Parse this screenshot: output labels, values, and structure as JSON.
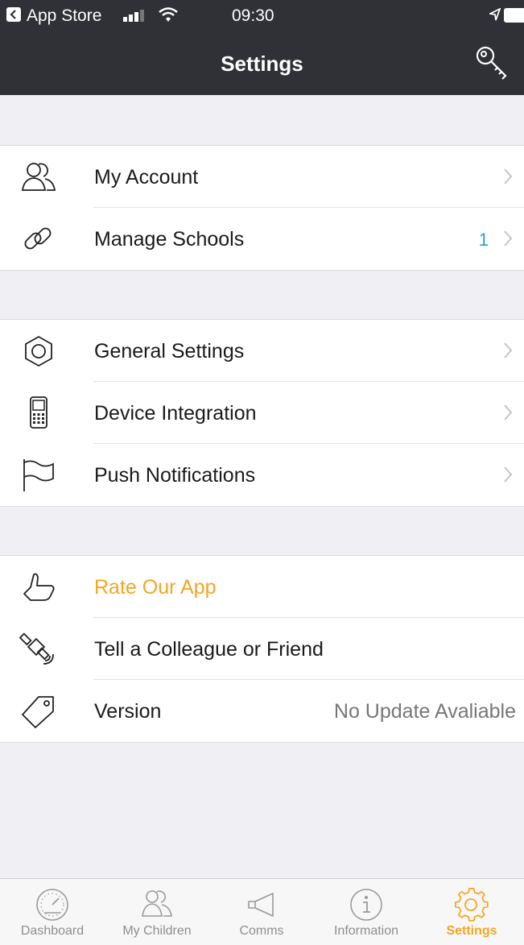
{
  "status_bar": {
    "carrier": "App Store",
    "time": "09:30"
  },
  "nav": {
    "title": "Settings",
    "right_icon": "key-icon"
  },
  "sections": [
    {
      "rows": [
        {
          "icon": "users-icon",
          "label": "My Account",
          "chevron": true
        },
        {
          "icon": "link-icon",
          "label": "Manage Schools",
          "count": "1",
          "chevron": true
        }
      ]
    },
    {
      "rows": [
        {
          "icon": "hexagon-settings-icon",
          "label": "General Settings",
          "chevron": true
        },
        {
          "icon": "device-icon",
          "label": "Device Integration",
          "chevron": true
        },
        {
          "icon": "flag-icon",
          "label": "Push Notifications",
          "chevron": true
        }
      ]
    },
    {
      "rows": [
        {
          "icon": "thumbs-up-icon",
          "label": "Rate Our App",
          "accent": true
        },
        {
          "icon": "satellite-icon",
          "label": "Tell a Colleague or Friend"
        },
        {
          "icon": "tag-icon",
          "label": "Version",
          "value": "No Update Avaliable"
        }
      ]
    }
  ],
  "tabbar": {
    "tabs": [
      {
        "icon": "speedometer-icon",
        "label": "Dashboard"
      },
      {
        "icon": "children-icon",
        "label": "My Children"
      },
      {
        "icon": "megaphone-icon",
        "label": "Comms"
      },
      {
        "icon": "info-icon",
        "label": "Information"
      },
      {
        "icon": "gear-icon",
        "label": "Settings",
        "active": true
      }
    ]
  },
  "colors": {
    "header_bg": "#2f3136",
    "accent": "#f5a623",
    "count_blue": "#2a9de0",
    "group_bg": "#efeff4"
  }
}
